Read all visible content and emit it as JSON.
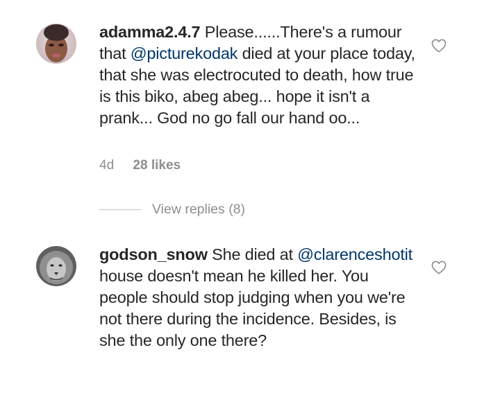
{
  "comments": [
    {
      "username": "adamma2.4.7",
      "text_parts": [
        {
          "text": "Please......There's  a rumour that ",
          "type": "plain"
        },
        {
          "text": "@picturekodak",
          "type": "mention"
        },
        {
          "text": "  died at your place today, that she was electrocuted to death, how true is this biko, abeg abeg... hope it isn't  a prank... God no go fall our hand oo...",
          "type": "plain"
        }
      ],
      "time": "4d",
      "likes": "28 likes",
      "replies_label": "View replies (8)"
    },
    {
      "username": "godson_snow",
      "text_parts": [
        {
          "text": "She died at ",
          "type": "plain"
        },
        {
          "text": "@clarenceshotit",
          "type": "mention"
        },
        {
          "text": " house doesn't mean he killed her. You people should stop judging when you we're not there during the incidence. Besides, is she the only one there?",
          "type": "plain"
        }
      ]
    }
  ],
  "colors": {
    "mention": "#00376b",
    "meta": "#8e8e8e",
    "text": "#262626"
  },
  "icons": [
    "heart-outline-icon",
    "avatar-woman-photo",
    "avatar-lion-photo"
  ]
}
